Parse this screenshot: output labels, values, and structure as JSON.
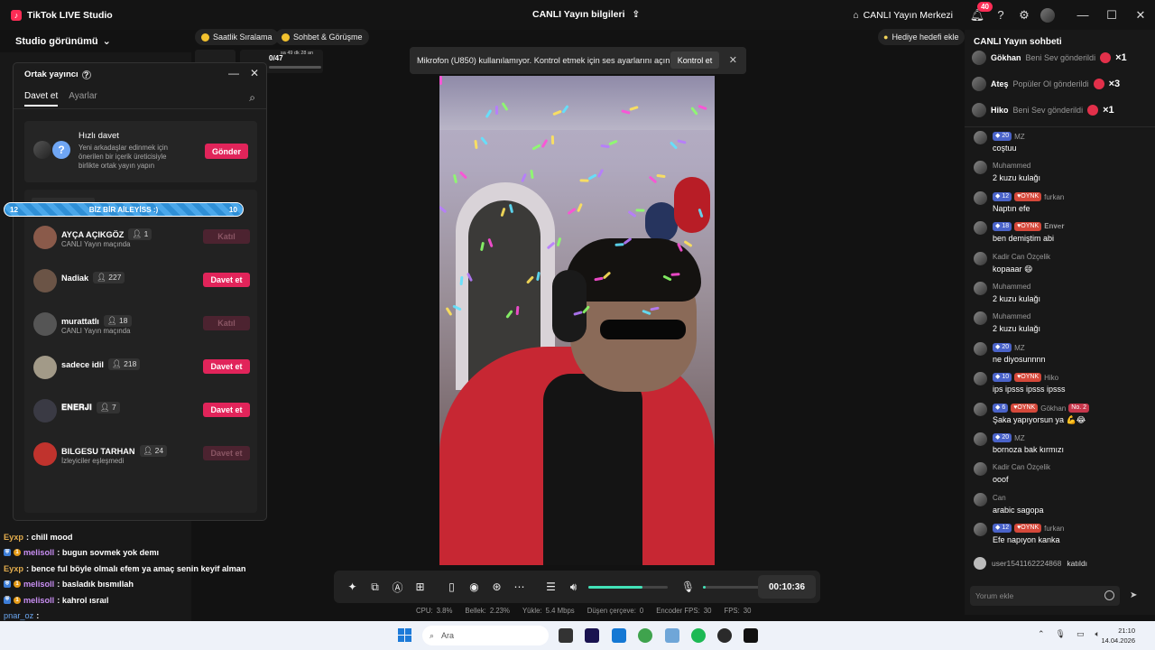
{
  "app": {
    "title": "TikTok LIVE Studio",
    "logo_icon": "tiktok-logo-icon"
  },
  "header": {
    "center_title": "CANLI Yayın bilgileri",
    "live_center_label": "CANLI Yayın Merkezi",
    "notification_count": "40"
  },
  "left": {
    "studio_view_label": "Studio görünümü",
    "chips": [
      {
        "label": "Saatlik Sıralama"
      },
      {
        "label": "Sohbet & Görüşme"
      }
    ],
    "mini_counter": "0/47",
    "mini_timer": "sa 49 dk 28 an"
  },
  "cohost": {
    "title": "Ortak yayıncı",
    "tabs": [
      {
        "label": "Davet et"
      },
      {
        "label": "Ayarlar"
      }
    ],
    "quick_invite": {
      "title": "Hızlı davet",
      "desc": "Yeni arkadaşlar edinmek için önerilen bir içerik üreticisiyle birlikte ortak yayın yapın",
      "button": "Gönder",
      "avatar_placeholder": "?"
    },
    "hosts": [
      {
        "name": "AYÇA AÇIKGÖZ",
        "count": "1",
        "status": "CANLI Yayın maçında",
        "button": "Katıl",
        "enabled": false,
        "avatar": "#8a5a4a"
      },
      {
        "name": "Nadiak",
        "count": "227",
        "status": "",
        "button": "Davet et",
        "enabled": true,
        "avatar": "#6b5446"
      },
      {
        "name": "murattatlı",
        "count": "18",
        "status": "CANLI Yayın maçında",
        "button": "Katıl",
        "enabled": false,
        "avatar": "#555555"
      },
      {
        "name": "sadece idil",
        "count": "218",
        "status": "",
        "button": "Davet et",
        "enabled": true,
        "avatar": "#a29a88"
      },
      {
        "name": "𝐄𝐍𝐄𝐑𝐉𝐈",
        "count": "7",
        "status": "",
        "button": "Davet et",
        "enabled": true,
        "avatar": "#3a3a44"
      },
      {
        "name": "BILGESU TARHAN",
        "count": "24",
        "status": "İzleyiciler eşleşmedi",
        "button": "Davet et",
        "enabled": false,
        "avatar": "#c0332d"
      }
    ]
  },
  "goal_bar": {
    "left_value": "12",
    "label": "BİZ BİR AİLEYİSS :)",
    "right_value": "10"
  },
  "overlay_chat": [
    {
      "name": "Eyxp",
      "style": "orange",
      "text": ": chill mood",
      "badges": false
    },
    {
      "name": "melisoll",
      "style": "purple",
      "text": ": bugun sovmek yok demı",
      "badges": true
    },
    {
      "name": "Eyxp",
      "style": "orange",
      "text": ": bence ful böyle olmalı efem ya amaç senin keyif alman",
      "badges": false
    },
    {
      "name": "melisoll",
      "style": "purple",
      "text": ": basladık bısmıllah",
      "badges": true
    },
    {
      "name": "melisoll",
      "style": "purple",
      "text": ": kahrol ısraıl",
      "badges": true
    },
    {
      "name": "pnar_oz",
      "style": "blue",
      "text": ":",
      "badges": false
    }
  ],
  "warning": {
    "text": "Mikrofon (U850) kullanılamıyor. Kontrol etmek için ses ayarlarını açın.",
    "button": "Kontrol et"
  },
  "controls": {
    "timer": "00:10:36",
    "volume_level": 0.68,
    "mic_level": 0.04
  },
  "stats": [
    {
      "label": "CPU:",
      "value": "3.8%"
    },
    {
      "label": "Bellek:",
      "value": "2.23%"
    },
    {
      "label": "Yükle:",
      "value": "5.4 Mbps"
    },
    {
      "label": "Düşen çerçeve:",
      "value": "0"
    },
    {
      "label": "Encoder FPS:",
      "value": "30"
    },
    {
      "label": "FPS:",
      "value": "30"
    }
  ],
  "chat": {
    "gift_goal_label": "Hediye hedefi ekle",
    "title": "CANLI Yayın sohbeti",
    "gifts": [
      {
        "name": "Gökhan",
        "desc": "Beni Sev gönderildi",
        "count": "×1"
      },
      {
        "name": "Ateş",
        "desc": "Popüler Ol gönderildi",
        "count": "×3"
      },
      {
        "name": "Hiko",
        "desc": "Beni Sev gönderildi",
        "count": "×1"
      }
    ],
    "messages": [
      {
        "level": "20",
        "club": "",
        "name": "MZ",
        "text": "coştuu"
      },
      {
        "level": "",
        "club": "",
        "name": "Muhammed",
        "text": "2 kuzu kulağı"
      },
      {
        "level": "12",
        "club": "OYNK",
        "name": "furkan",
        "text": "Naptın efe"
      },
      {
        "level": "18",
        "club": "OYNK",
        "name": "𝐄𝐧𝐯𝐞𝐫",
        "text": "ben demiştim abi"
      },
      {
        "level": "",
        "club": "",
        "name": "Kadir Can Özçelik",
        "text": "kopaaar 😄"
      },
      {
        "level": "",
        "club": "",
        "name": "Muhammed",
        "text": "2 kuzu kulağı"
      },
      {
        "level": "",
        "club": "",
        "name": "Muhammed",
        "text": "2 kuzu kulağı"
      },
      {
        "level": "20",
        "club": "",
        "name": "MZ",
        "text": "ne diyosunnnn"
      },
      {
        "level": "10",
        "club": "OYNK",
        "name": "Hiko",
        "text": "ips ipsss ipsss ipsss"
      },
      {
        "level": "6",
        "club": "OYNK",
        "name": "Gökhan",
        "extra": "No. 2",
        "text": "Şaka yapıyorsun ya 💪😂"
      },
      {
        "level": "20",
        "club": "",
        "name": "MZ",
        "text": "bornoza bak kırmızı"
      },
      {
        "level": "",
        "club": "",
        "name": "Kadir Can Özçelik",
        "text": "ooof"
      },
      {
        "level": "",
        "club": "",
        "name": "Can",
        "text": "arabic sagopa"
      },
      {
        "level": "12",
        "club": "OYNK",
        "name": "furkan",
        "text": "Efe napıyon kanka"
      }
    ],
    "join_user": "user1541162224868",
    "join_text": "katıldı",
    "comment_placeholder": "Yorum ekle"
  },
  "taskbar": {
    "search_placeholder": "Ara",
    "time": "21:10",
    "date": "14.04.2026"
  }
}
